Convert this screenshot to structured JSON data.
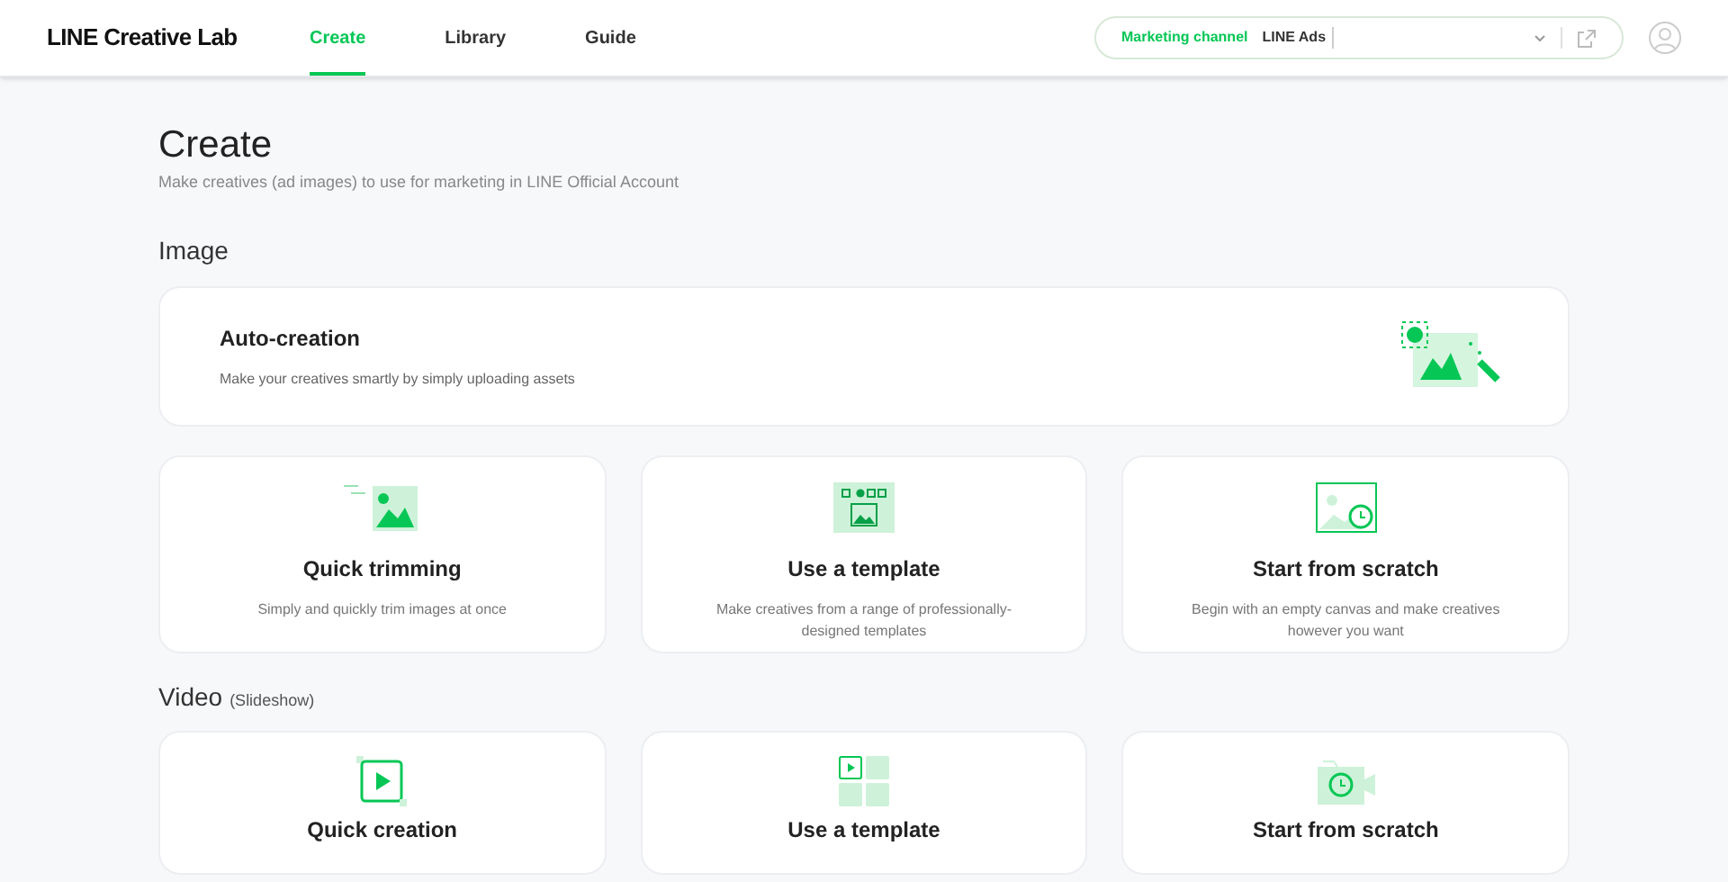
{
  "header": {
    "logo": "LINE Creative Lab",
    "tabs": [
      {
        "label": "Create",
        "selected": true
      },
      {
        "label": "Library",
        "selected": false
      },
      {
        "label": "Guide",
        "selected": false
      }
    ],
    "channel": {
      "label": "Marketing channel",
      "value": "LINE Ads"
    }
  },
  "page": {
    "title": "Create",
    "subtitle": "Make creatives (ad images) to use for marketing in LINE Official Account"
  },
  "sections": [
    {
      "title": "Image",
      "featured": {
        "title": "Auto-creation",
        "description": "Make your creatives smartly by simply uploading assets"
      },
      "cards": [
        {
          "title": "Quick trimming",
          "description": "Simply and quickly trim images at once"
        },
        {
          "title": "Use a template",
          "description": "Make creatives from a range of professionally-designed templates"
        },
        {
          "title": "Start from scratch",
          "description": "Begin with an empty canvas and make creatives however you want"
        }
      ]
    },
    {
      "title": "Video",
      "note": "(Slideshow)",
      "cards": [
        {
          "title": "Quick creation"
        },
        {
          "title": "Use a template"
        },
        {
          "title": "Start from scratch"
        }
      ]
    }
  ]
}
